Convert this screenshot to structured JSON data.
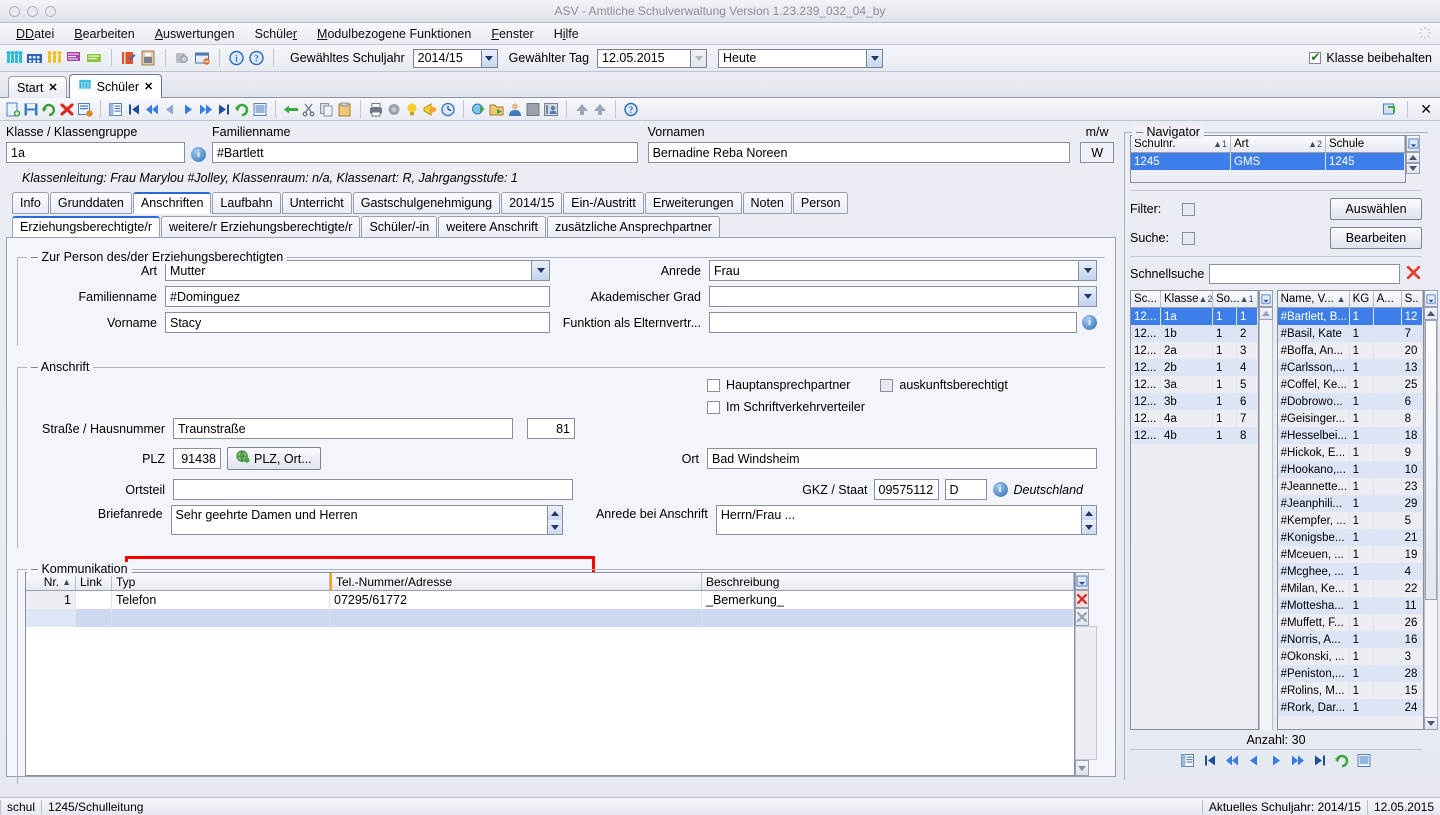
{
  "window": {
    "title": "ASV - Amtliche Schulverwaltung Version 1.23.239_032_04_by"
  },
  "menubar": {
    "items": [
      "Datei",
      "Bearbeiten",
      "Auswertungen",
      "Schüler",
      "Modulbezogene Funktionen",
      "Fenster",
      "Hilfe"
    ]
  },
  "toolbar": {
    "schuljahr_label": "Gewähltes Schuljahr",
    "schuljahr_value": "2014/15",
    "tag_label": "Gewählter Tag",
    "tag_value": "12.05.2015",
    "heute_value": "Heute",
    "keep_class_label": "Klasse beibehalten",
    "keep_class_checked": true
  },
  "window_tabs": [
    {
      "label": "Start",
      "active": false
    },
    {
      "label": "Schüler",
      "active": true
    }
  ],
  "header_fields": {
    "klasse_label": "Klasse / Klassengruppe",
    "klasse_value": "1a",
    "familienname_label": "Familienname",
    "familienname_value": "#Bartlett",
    "vornamen_label": "Vornamen",
    "vornamen_value": "Bernadine Reba Noreen",
    "mw_label": "m/w",
    "mw_value": "W",
    "classinfo": "Klassenleitung: Frau Marylou #Jolley, Klassenraum: n/a, Klassenart: R, Jahrgangsstufe: 1"
  },
  "main_tabs": [
    {
      "label": "Info",
      "active": false
    },
    {
      "label": "Grunddaten",
      "active": false
    },
    {
      "label": "Anschriften",
      "active": true
    },
    {
      "label": "Laufbahn",
      "active": false
    },
    {
      "label": "Unterricht",
      "active": false
    },
    {
      "label": "Gastschulgenehmigung",
      "active": false
    },
    {
      "label": "2014/15",
      "active": false
    },
    {
      "label": "Ein-/Austritt",
      "active": false
    },
    {
      "label": "Erweiterungen",
      "active": false
    },
    {
      "label": "Noten",
      "active": false
    },
    {
      "label": "Person",
      "active": false
    }
  ],
  "sub_tabs": [
    {
      "label": "Erziehungsberechtigte/r",
      "active": true
    },
    {
      "label": "weitere/r Erziehungsberechtigte/r",
      "active": false
    },
    {
      "label": "Schüler/-in",
      "active": false
    },
    {
      "label": "weitere Anschrift",
      "active": false
    },
    {
      "label": "zusätzliche Ansprechpartner",
      "active": false
    }
  ],
  "person_group": {
    "title": "Zur Person des/der Erziehungsberechtigten",
    "art_label": "Art",
    "art_value": "Mutter",
    "familienname_label": "Familienname",
    "familienname_value": "#Dominguez",
    "vorname_label": "Vorname",
    "vorname_value": "Stacy",
    "anrede_label": "Anrede",
    "anrede_value": "Frau",
    "akad_grad_label": "Akademischer Grad",
    "akad_grad_value": "",
    "funktion_label": "Funktion als Elternvertr...",
    "funktion_value": ""
  },
  "anschrift_group": {
    "title": "Anschrift",
    "checkboxes": [
      {
        "label": "Hauptansprechpartner",
        "checked": false,
        "disabled": false
      },
      {
        "label": "auskunftsberechtigt",
        "checked": false,
        "disabled": true
      },
      {
        "label": "Im Schriftverkehrverteiler",
        "checked": false,
        "disabled": false
      }
    ],
    "strasse_label": "Straße / Hausnummer",
    "strasse_value": "Traunstraße",
    "hausnummer_value": "81",
    "plz_label": "PLZ",
    "plz_value": "91438",
    "plz_ort_button": "PLZ, Ort...",
    "ortsteil_label": "Ortsteil",
    "ortsteil_value": "",
    "ort_label": "Ort",
    "ort_value": "Bad Windsheim",
    "gkz_label": "GKZ / Staat",
    "gkz_value": "09575112",
    "staat_value": "D",
    "staat_name": "Deutschland",
    "briefanrede_label": "Briefanrede",
    "briefanrede_value": "Sehr geehrte Damen und Herren",
    "anrede_anschrift_label": "Anrede bei Anschrift",
    "anrede_anschrift_value": "Herrn/Frau ..."
  },
  "kommunikation": {
    "title": "Kommunikation",
    "columns": [
      "Nr.",
      "Link",
      "Typ",
      "Tel.-Nummer/Adresse",
      "Beschreibung"
    ],
    "rows": [
      {
        "nr": "1",
        "link": "",
        "typ": "Telefon",
        "nummer": "07295/61772",
        "beschreibung": "_Bemerkung_"
      },
      {
        "nr": "",
        "link": "",
        "typ": "",
        "nummer": "",
        "beschreibung": ""
      }
    ]
  },
  "navigator": {
    "title": "Navigator",
    "school_columns": [
      {
        "label": "Schulnr.",
        "sort": "▲1"
      },
      {
        "label": "Art",
        "sort": "▲2"
      },
      {
        "label": "Schule",
        "sort": ""
      }
    ],
    "school_rows": [
      {
        "schulnr": "1245",
        "art": "GMS",
        "schule": "1245",
        "selected": true
      }
    ],
    "filter_label": "Filter:",
    "filter_checked": false,
    "suche_label": "Suche:",
    "suche_checked": false,
    "auswaehlen_button": "Auswählen",
    "bearbeiten_button": "Bearbeiten",
    "schnellsuche_label": "Schnellsuche",
    "schnellsuche_value": "",
    "class_columns": [
      {
        "label": "Sc...",
        "sort": ""
      },
      {
        "label": "Klasse",
        "sort": "▲2"
      },
      {
        "label": "So...",
        "sort": "▲1"
      }
    ],
    "class_rows": [
      {
        "sc": "12...",
        "klasse": "1a",
        "kg": "1",
        "so": "1",
        "selected": true
      },
      {
        "sc": "12...",
        "klasse": "1b",
        "kg": "1",
        "so": "2",
        "selected": false
      },
      {
        "sc": "12...",
        "klasse": "2a",
        "kg": "1",
        "so": "3",
        "selected": false
      },
      {
        "sc": "12...",
        "klasse": "2b",
        "kg": "1",
        "so": "4",
        "selected": false
      },
      {
        "sc": "12...",
        "klasse": "3a",
        "kg": "1",
        "so": "5",
        "selected": false
      },
      {
        "sc": "12...",
        "klasse": "3b",
        "kg": "1",
        "so": "6",
        "selected": false
      },
      {
        "sc": "12...",
        "klasse": "4a",
        "kg": "1",
        "so": "7",
        "selected": false
      },
      {
        "sc": "12...",
        "klasse": "4b",
        "kg": "1",
        "so": "8",
        "selected": false
      }
    ],
    "student_columns": [
      {
        "label": "Name, V...",
        "sort": "▲"
      },
      {
        "label": "KG",
        "sort": ""
      },
      {
        "label": "A...",
        "sort": ""
      },
      {
        "label": "S..",
        "sort": ""
      }
    ],
    "student_rows": [
      {
        "name": "#Bartlett, B...",
        "kg": "1",
        "a": "",
        "s": "12",
        "selected": true
      },
      {
        "name": "#Basil, Kate",
        "kg": "1",
        "a": "",
        "s": "7",
        "selected": false
      },
      {
        "name": "#Boffa, An...",
        "kg": "1",
        "a": "",
        "s": "20",
        "selected": false
      },
      {
        "name": "#Carlsson,...",
        "kg": "1",
        "a": "",
        "s": "13",
        "selected": false
      },
      {
        "name": "#Coffel, Ke...",
        "kg": "1",
        "a": "",
        "s": "25",
        "selected": false
      },
      {
        "name": "#Dobrowo...",
        "kg": "1",
        "a": "",
        "s": "6",
        "selected": false
      },
      {
        "name": "#Geisinger...",
        "kg": "1",
        "a": "",
        "s": "8",
        "selected": false
      },
      {
        "name": "#Hesselbei...",
        "kg": "1",
        "a": "",
        "s": "18",
        "selected": false
      },
      {
        "name": "#Hickok, E...",
        "kg": "1",
        "a": "",
        "s": "9",
        "selected": false
      },
      {
        "name": "#Hookano,...",
        "kg": "1",
        "a": "",
        "s": "10",
        "selected": false
      },
      {
        "name": "#Jeannette...",
        "kg": "1",
        "a": "",
        "s": "23",
        "selected": false
      },
      {
        "name": "#Jeanphili...",
        "kg": "1",
        "a": "",
        "s": "29",
        "selected": false
      },
      {
        "name": "#Kempfer, ...",
        "kg": "1",
        "a": "",
        "s": "5",
        "selected": false
      },
      {
        "name": "#Konigsbe...",
        "kg": "1",
        "a": "",
        "s": "21",
        "selected": false
      },
      {
        "name": "#Mceuen, ...",
        "kg": "1",
        "a": "",
        "s": "19",
        "selected": false
      },
      {
        "name": "#Mcghee, ...",
        "kg": "1",
        "a": "",
        "s": "4",
        "selected": false
      },
      {
        "name": "#Milan, Ke...",
        "kg": "1",
        "a": "",
        "s": "22",
        "selected": false
      },
      {
        "name": "#Mottesha...",
        "kg": "1",
        "a": "",
        "s": "11",
        "selected": false
      },
      {
        "name": "#Muffett, F...",
        "kg": "1",
        "a": "",
        "s": "26",
        "selected": false
      },
      {
        "name": "#Norris, A...",
        "kg": "1",
        "a": "",
        "s": "16",
        "selected": false
      },
      {
        "name": "#Okonski, ...",
        "kg": "1",
        "a": "",
        "s": "3",
        "selected": false
      },
      {
        "name": "#Peniston,...",
        "kg": "1",
        "a": "",
        "s": "28",
        "selected": false
      },
      {
        "name": "#Rolins, M...",
        "kg": "1",
        "a": "",
        "s": "15",
        "selected": false
      },
      {
        "name": "#Rork, Dar...",
        "kg": "1",
        "a": "",
        "s": "24",
        "selected": false
      }
    ],
    "anzahl_label": "Anzahl: 30"
  },
  "statusbar": {
    "user": "schul",
    "context": "1245/Schulleitung",
    "schuljahr": "Aktuelles Schuljahr: 2014/15",
    "date": "12.05.2015"
  },
  "colors": {
    "selection_blue": "#3d7ee8",
    "alt_row": "#dbe5f6",
    "highlight_red": "#ff0000",
    "active_tab_accent": "#2b6cd4"
  }
}
